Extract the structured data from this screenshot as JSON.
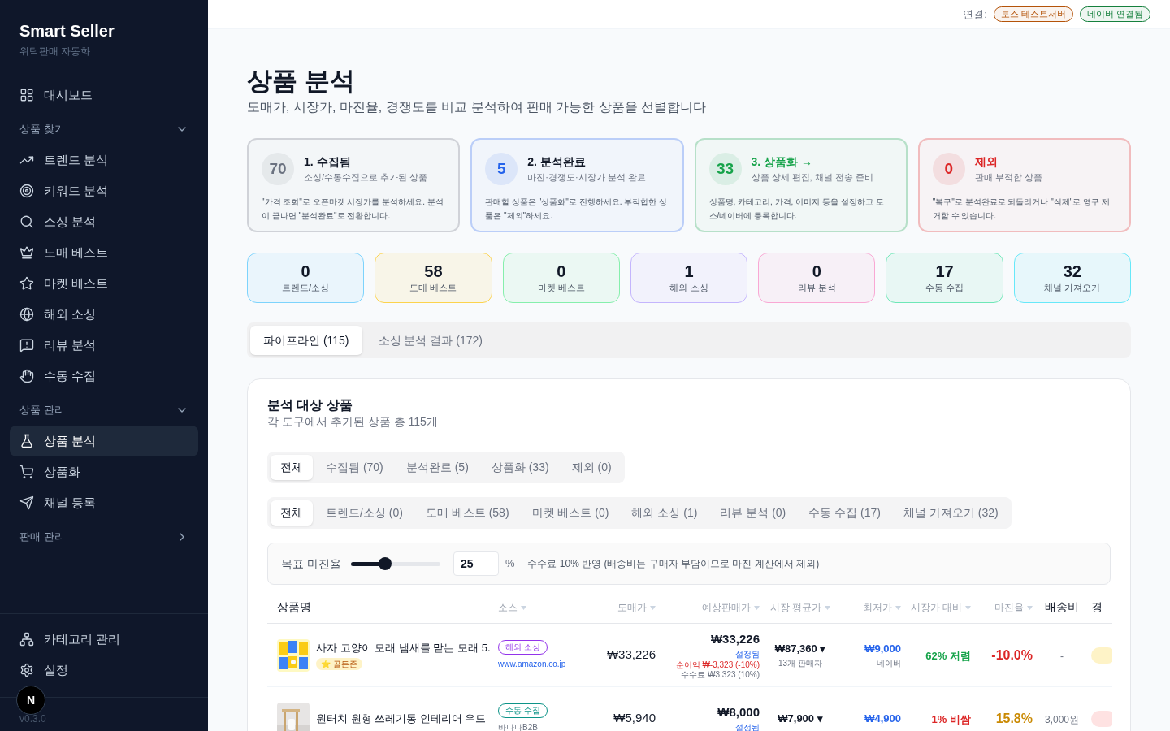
{
  "sidebar": {
    "brand": "Smart Seller",
    "tagline": "위탁판매 자동화",
    "top_items": [
      {
        "label": "대시보드",
        "selected": false
      }
    ],
    "groups": [
      {
        "label": "상품 찾기",
        "expanded": true,
        "items": [
          {
            "label": "트렌드 분석",
            "selected": false
          },
          {
            "label": "키워드 분석",
            "selected": false
          },
          {
            "label": "소싱 분석",
            "selected": false
          },
          {
            "label": "도매 베스트",
            "selected": false
          },
          {
            "label": "마켓 베스트",
            "selected": false
          },
          {
            "label": "해외 소싱",
            "selected": false
          },
          {
            "label": "리뷰 분석",
            "selected": false
          },
          {
            "label": "수동 수집",
            "selected": false
          }
        ]
      },
      {
        "label": "상품 관리",
        "expanded": true,
        "items": [
          {
            "label": "상품 분석",
            "selected": true
          },
          {
            "label": "상품화",
            "selected": false
          },
          {
            "label": "채널 등록",
            "selected": false
          }
        ]
      },
      {
        "label": "판매 관리",
        "expanded": false
      }
    ],
    "bottom_items": [
      {
        "label": "카테고리 관리",
        "selected": false
      },
      {
        "label": "설정",
        "selected": false
      }
    ],
    "version": "v0.3.0",
    "dev_badge": "N"
  },
  "top_bar": {
    "label": "연결:",
    "connections": [
      {
        "label": "토스 테스트서버",
        "color": "#b45309"
      },
      {
        "label": "네이버 연결됨",
        "color": "#15803d"
      }
    ]
  },
  "page": {
    "title": "상품 분석",
    "subtitle": "도매가, 시장가, 마진율, 경쟁도를 비교 분석하여 판매 가능한 상품을 선별합니다"
  },
  "stages": [
    {
      "count": "70",
      "title": "1. 수집됨",
      "subtitle": "소싱/수동수집으로 추가된 상품",
      "description": "\"가격 조회\"로 오픈마켓 시장가를 분석하세요. 분석이 끝나면 \"분석완료\"로 전환합니다.",
      "color": "#6b7280"
    },
    {
      "count": "5",
      "title": "2. 분석완료",
      "subtitle": "마진·경쟁도·시장가 분석 완료",
      "description": "판매할 상품은 \"상품화\"로 진행하세요. 부적합한 상품은 \"제외\"하세요.",
      "color": "#2563eb"
    },
    {
      "count": "33",
      "title": "3. 상품화 →",
      "subtitle": "상품 상세 편집, 채널 전송 준비",
      "description": "상품명, 카테고리, 가격, 이미지 등을 설정하고 토스/네이버에 등록합니다.",
      "color": "#16a34a"
    },
    {
      "count": "0",
      "title": "제외",
      "subtitle": "판매 부적합 상품",
      "description": "\"복구\"로 분석완료로 되돌리거나 \"삭제\"로 영구 제거할 수 있습니다.",
      "color": "#dc2626"
    }
  ],
  "source_counts": [
    {
      "count": "0",
      "label": "트렌드/소싱",
      "color": "#7dd3fc"
    },
    {
      "count": "58",
      "label": "도매 베스트",
      "color": "#fcd34d"
    },
    {
      "count": "0",
      "label": "마켓 베스트",
      "color": "#86efac"
    },
    {
      "count": "1",
      "label": "해외 소싱",
      "color": "#c4b5fd"
    },
    {
      "count": "0",
      "label": "리뷰 분석",
      "color": "#f9a8d4"
    },
    {
      "count": "17",
      "label": "수동 수집",
      "color": "#6ee7b7"
    },
    {
      "count": "32",
      "label": "채널 가져오기",
      "color": "#67e8f9"
    }
  ],
  "tabs": [
    {
      "label": "파이프라인 (115)",
      "selected": true
    },
    {
      "label": "소싱 분석 결과 (172)",
      "selected": false
    }
  ],
  "panel": {
    "title": "분석 대상 상품",
    "subtitle": "각 도구에서 추가된 상품 총 115개",
    "status_filters": [
      {
        "label": "전체",
        "selected": true
      },
      {
        "label": "수집됨 (70)",
        "selected": false
      },
      {
        "label": "분석완료 (5)",
        "selected": false
      },
      {
        "label": "상품화 (33)",
        "selected": false
      },
      {
        "label": "제외 (0)",
        "selected": false
      }
    ],
    "source_filters": [
      {
        "label": "전체",
        "selected": true
      },
      {
        "label": "트렌드/소싱 (0)",
        "selected": false
      },
      {
        "label": "도매 베스트 (58)",
        "selected": false
      },
      {
        "label": "마켓 베스트 (0)",
        "selected": false
      },
      {
        "label": "해외 소싱 (1)",
        "selected": false
      },
      {
        "label": "리뷰 분석 (0)",
        "selected": false
      },
      {
        "label": "수동 수집 (17)",
        "selected": false
      },
      {
        "label": "채널 가져오기 (32)",
        "selected": false
      }
    ],
    "margin": {
      "label": "목표 마진율",
      "level": 0.38,
      "value": "25",
      "unit": "%",
      "note": "수수료 10% 반영 (배송비는 구매자 부담이므로 마진 계산에서 제외)"
    },
    "table": {
      "columns": [
        {
          "label": "상품명",
          "sortable": false
        },
        {
          "label": "소스",
          "sortable": true
        },
        {
          "label": "도매가",
          "sortable": true
        },
        {
          "label": "예상판매가",
          "sortable": true
        },
        {
          "label": "시장 평균가",
          "sortable": true
        },
        {
          "label": "최저가",
          "sortable": true
        },
        {
          "label": "시장가 대비",
          "sortable": true
        },
        {
          "label": "마진율",
          "sortable": true
        },
        {
          "label": "배송비",
          "sortable": false
        },
        {
          "label": "경",
          "sortable": false
        }
      ],
      "rows": [
        {
          "name": "사자 고양이 모래 냄새를 맡는 모래 5.",
          "tag": "⭐ 골든존",
          "source": {
            "label": "해외 소싱",
            "color": "#9333ea"
          },
          "source_detail": "www.amazon.co.jp",
          "source_link": true,
          "wholesale": "₩33,226",
          "sale_price": "₩33,226",
          "sale_note": "설정됨",
          "profit": {
            "text": "순이익 ₩-3,323 (-10%)",
            "color": "#dc2626"
          },
          "fee": "수수료 ₩3,323 (10%)",
          "market_avg": "₩87,360 ▾",
          "sellers": "13개 판매자",
          "lowest": "₩9,000",
          "lowest_channel": "네이버",
          "compare": {
            "text": "62% 저렴",
            "color": "#16a34a"
          },
          "margin": {
            "text": "-10.0%",
            "color": "#dc2626"
          },
          "shipping": "-",
          "badge": {
            "color": "#fef3c7"
          }
        },
        {
          "name": "원터치 원형 쓰레기통 인테리어 우드",
          "source": {
            "label": "수동 수집",
            "color": "#0d9488"
          },
          "source_detail": "바나나B2B",
          "source_link": false,
          "wholesale": "₩5,940",
          "sale_price": "₩8,000",
          "sale_note": "설정됨",
          "market_avg": "₩7,900 ▾",
          "lowest": "₩4,900",
          "compare": {
            "text": "1% 비쌈",
            "color": "#dc2626"
          },
          "margin": {
            "text": "15.8%",
            "color": "#ca8a04"
          },
          "shipping": "3,000원",
          "badge": {
            "color": "#fee2e2"
          }
        }
      ]
    }
  }
}
